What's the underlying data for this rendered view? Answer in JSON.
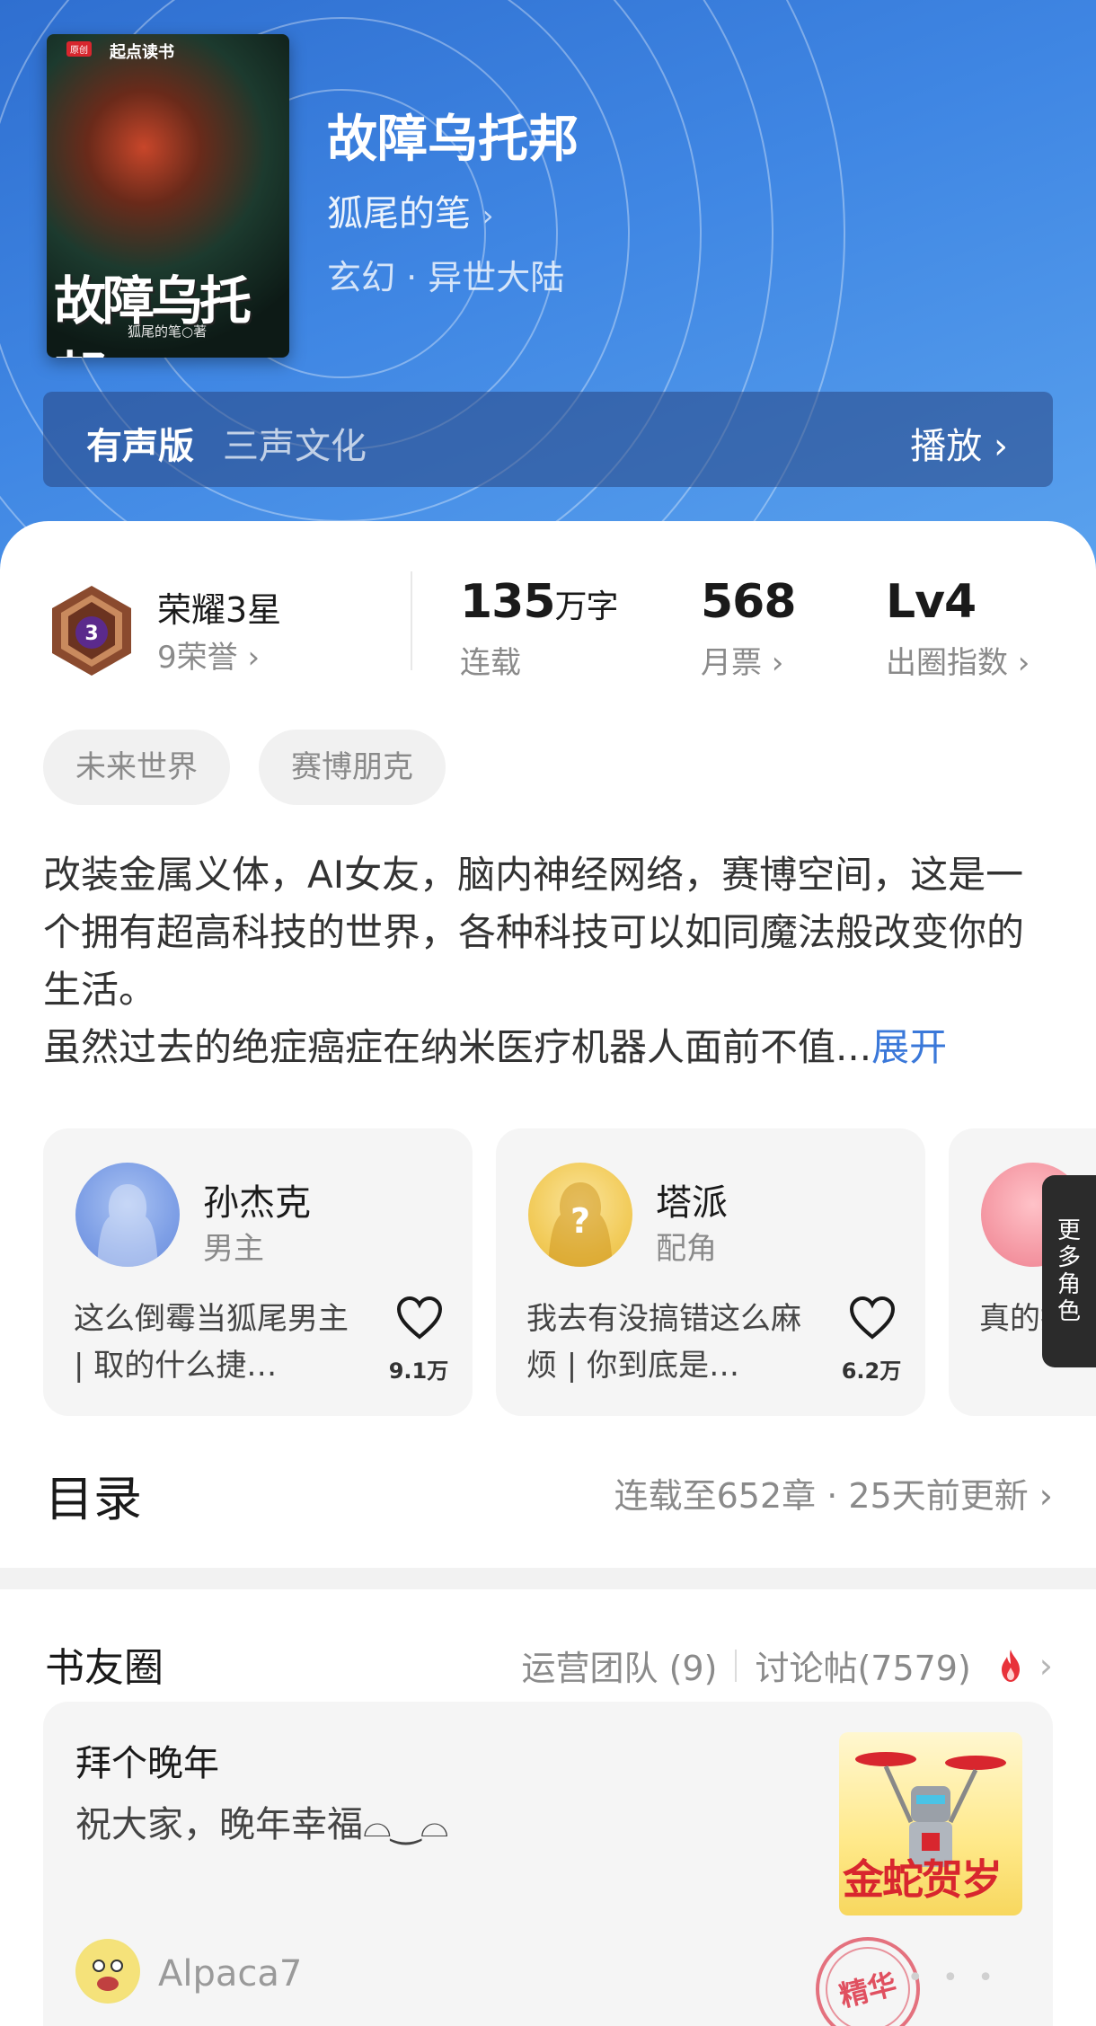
{
  "book": {
    "title": "故障乌托邦",
    "author": "狐尾的笔",
    "author_chevron": "›",
    "genre": "玄幻 · 异世大陆",
    "cover": {
      "brand": "起点读书",
      "brand_tag": "原创",
      "title_art": "故障乌托邦",
      "author_line": "狐尾的笔○著"
    }
  },
  "audio": {
    "label": "有声版",
    "studio": "三声文化",
    "play": "播放 ›"
  },
  "honor": {
    "title": "荣耀3星",
    "sub": "9荣誉 ›",
    "medal_level": "3"
  },
  "stats": [
    {
      "num": "135",
      "unit": "万字",
      "label": "连载"
    },
    {
      "num": "568",
      "unit": "",
      "label": "月票 ›"
    },
    {
      "num": "Lv4",
      "unit": "",
      "label": "出圈指数 ›"
    }
  ],
  "tags": [
    "未来世界",
    "赛博朋克"
  ],
  "description": {
    "text": "改装金属义体，AI女友，脑内神经网络，赛博空间，这是一个拥有超高科技的世界，各种科技可以如同魔法般改变你的生活。\n虽然过去的绝症癌症在纳米医疗机器人面前不值...",
    "expand": "展开"
  },
  "characters": [
    {
      "name": "孙杰克",
      "role": "男主",
      "quote": "这么倒霉当狐尾男主 | 取的什么捷…",
      "likes": "9.1万"
    },
    {
      "name": "塔派",
      "role": "配角",
      "quote": "我去有没搞错这么麻烦 | 你到底是…",
      "likes": "6.2万"
    },
    {
      "name": "",
      "role": "",
      "quote": "真的掀掀名字 | 只",
      "likes": ""
    }
  ],
  "more_characters": "更多角色",
  "toc": {
    "title": "目录",
    "meta": "连载至652章 · 25天前更新 ›"
  },
  "circle": {
    "title": "书友圈",
    "team": "运营团队 (9)",
    "posts": "讨论帖(7579)",
    "chevron": "›"
  },
  "post": {
    "title": "拜个晚年",
    "body": "祝大家，晚年幸福⌓‿⌓",
    "image_text": "金蛇贺岁",
    "user": "Alpaca7",
    "stamp": "精华",
    "dots": "• • •"
  },
  "colors": {
    "header_blue": "#3f86e3",
    "link_blue": "#3a78d9",
    "fire_red": "#e8323a",
    "medal_purple": "#5b2a8c"
  }
}
